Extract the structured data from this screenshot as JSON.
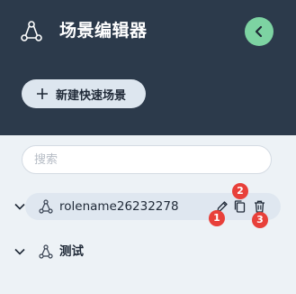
{
  "app": {
    "title": "场景编辑器",
    "icon": "scene-network-icon"
  },
  "collapse": {
    "icon": "chevron-left-icon",
    "color": "#7dd3a2"
  },
  "new_scene": {
    "label": "新建快速场景",
    "icon": "plus-icon"
  },
  "search": {
    "placeholder": "搜索",
    "value": ""
  },
  "tree": {
    "items": [
      {
        "label": "rolename26232278",
        "expanded": true,
        "icon": "scene-node-icon",
        "actions": [
          "edit-icon",
          "copy-icon",
          "delete-icon"
        ],
        "badges": [
          "1",
          "2",
          "3"
        ]
      },
      {
        "label": "测试",
        "expanded": true,
        "icon": "scene-node-icon"
      }
    ]
  },
  "colors": {
    "sidebar_dark": "#2c3a4b",
    "panel_light": "#edf2f6",
    "badge_red": "#e8403a"
  }
}
